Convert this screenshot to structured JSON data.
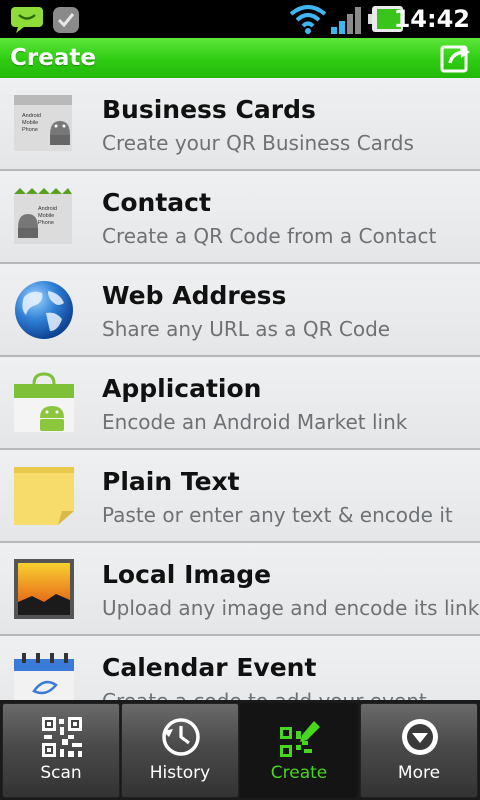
{
  "status_bar": {
    "time": "14:42",
    "icons": [
      "messaging-icon",
      "sync-icon",
      "wifi-icon",
      "signal-icon",
      "battery-icon"
    ]
  },
  "header": {
    "title": "Create",
    "action_icon": "share-icon"
  },
  "colors": {
    "accent": "#2fcc12",
    "active_tab": "#49d61f",
    "subtitle": "#6f7275"
  },
  "items": [
    {
      "title": "Business Cards",
      "subtitle": "Create your QR Business Cards",
      "icon": "business-card-icon"
    },
    {
      "title": "Contact",
      "subtitle": "Create a QR Code from a Contact",
      "icon": "contact-icon"
    },
    {
      "title": "Web Address",
      "subtitle": "Share any URL as a QR Code",
      "icon": "globe-icon"
    },
    {
      "title": "Application",
      "subtitle": "Encode an Android Market link",
      "icon": "market-bag-icon"
    },
    {
      "title": "Plain Text",
      "subtitle": "Paste or enter any text & encode it",
      "icon": "sticky-note-icon"
    },
    {
      "title": "Local Image",
      "subtitle": "Upload any image and encode its link",
      "icon": "picture-icon"
    },
    {
      "title": "Calendar Event",
      "subtitle": "Create a code to add your event",
      "icon": "calendar-icon"
    }
  ],
  "tabs": [
    {
      "label": "Scan",
      "icon": "qr-code-icon",
      "active": false
    },
    {
      "label": "History",
      "icon": "clock-icon",
      "active": false
    },
    {
      "label": "Create",
      "icon": "qr-create-icon",
      "active": true
    },
    {
      "label": "More",
      "icon": "chevron-down-circle-icon",
      "active": false
    }
  ],
  "thumb_text": {
    "android_phone": "Android Mobile Phone"
  }
}
